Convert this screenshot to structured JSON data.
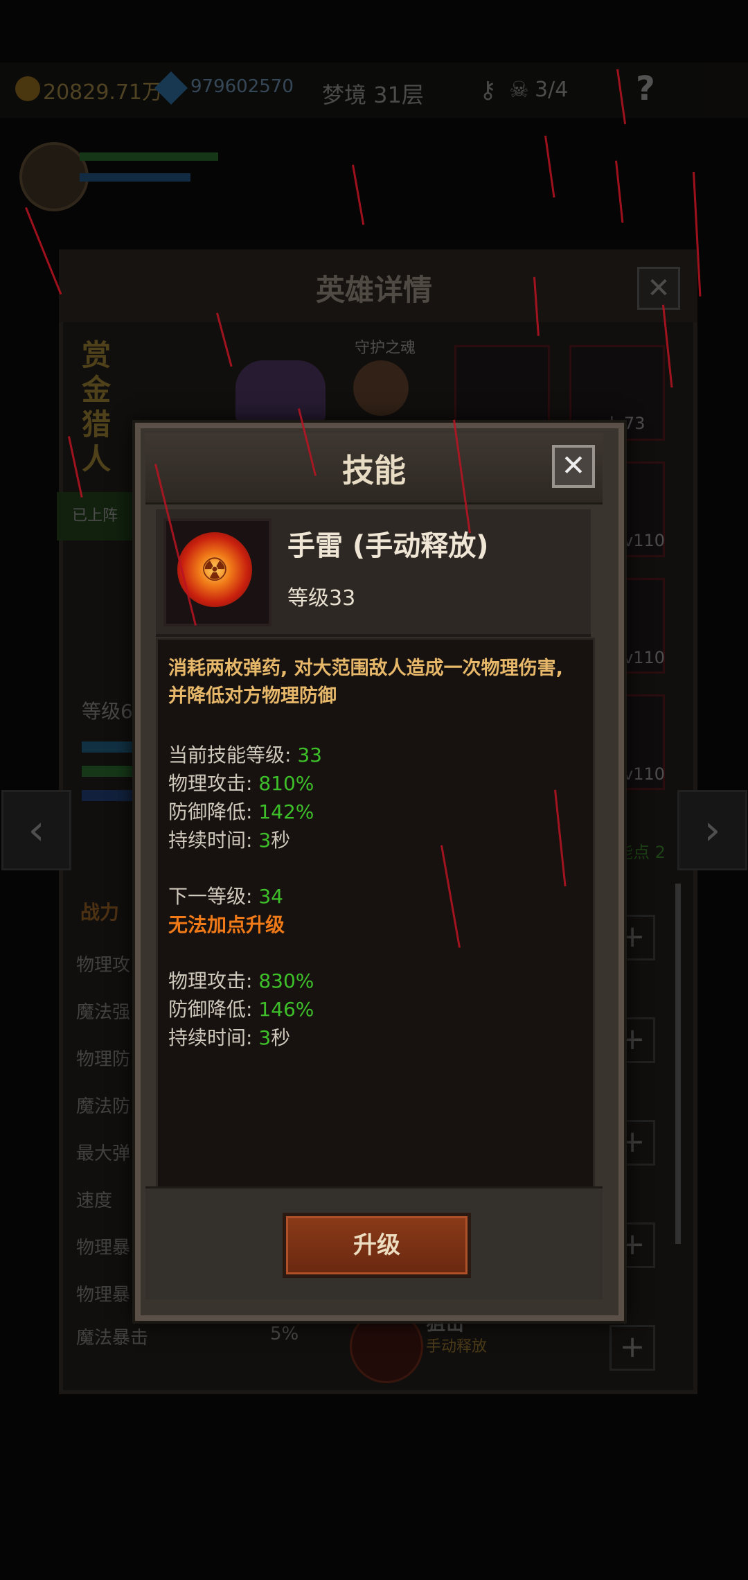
{
  "topbar": {
    "gold": "20829.71万",
    "gems": "979602570",
    "floor": "梦境 31层",
    "skull_count": "3/4",
    "help": "?"
  },
  "hero_panel": {
    "title": "英雄详情",
    "close": "✕",
    "hero_name": "赏金猎人",
    "guard_label": "守护之魂",
    "equip_levels": [
      "lv73",
      "v110",
      "v110",
      "v110"
    ],
    "team_status": "已上阵",
    "level_prefix": "等级6",
    "nav_prev": "‹",
    "nav_next": "›",
    "power_label": "战力",
    "stats": [
      "物理攻",
      "魔法强",
      "物理防",
      "魔法防",
      "最大弹",
      "速度",
      "物理暴",
      "物理暴",
      "魔法暴击"
    ],
    "magic_crit_value": "5%",
    "skill_points": "能点 2",
    "snipe_title": "狙击",
    "snipe_sub": "手动释放",
    "plus": "+"
  },
  "skill_modal": {
    "title": "技能",
    "close": "✕",
    "skill_name": "手雷 (手动释放)",
    "skill_level": "等级33",
    "description": "消耗两枚弹药, 对大范围敌人造成一次物理伤害, 并降低对方物理防御",
    "current": {
      "level_label": "当前技能等级: ",
      "level_value": "33",
      "attack_label": "物理攻击: ",
      "attack_value": "810%",
      "defense_label": "防御降低: ",
      "defense_value": "142%",
      "duration_label": "持续时间: ",
      "duration_value": "3",
      "duration_unit": "秒"
    },
    "next": {
      "level_label": "下一等级: ",
      "level_value": "34",
      "warning": "无法加点升级",
      "attack_label": "物理攻击: ",
      "attack_value": "830%",
      "defense_label": "防御降低: ",
      "defense_value": "146%",
      "duration_label": "持续时间: ",
      "duration_value": "3",
      "duration_unit": "秒"
    },
    "upgrade_button": "升级"
  },
  "colors": {
    "value_green": "#3ec02a",
    "warning_orange": "#f07a18",
    "description_gold": "#e7b86a",
    "rain_red": "#b81422"
  }
}
